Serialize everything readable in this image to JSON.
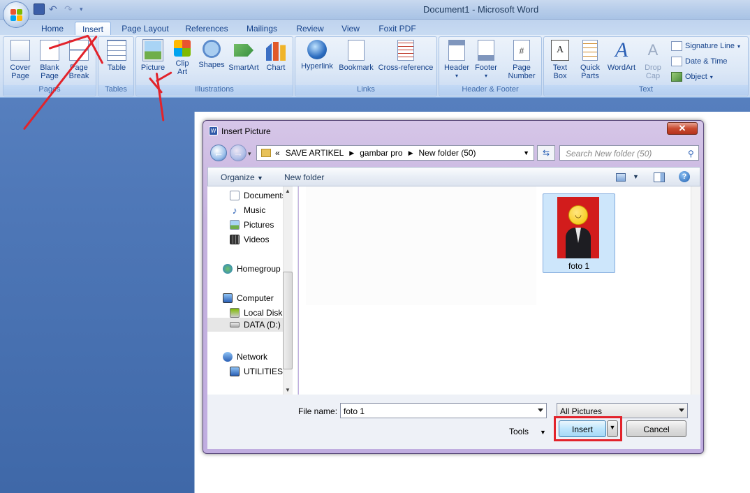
{
  "window": {
    "title": "Document1 - Microsoft Word"
  },
  "tabs": [
    "Home",
    "Insert",
    "Page Layout",
    "References",
    "Mailings",
    "Review",
    "View",
    "Foxit PDF"
  ],
  "active_tab": "Insert",
  "ribbon": {
    "pages": {
      "label": "Pages",
      "cover": "Cover\nPage",
      "blank": "Blank\nPage",
      "break": "Page\nBreak"
    },
    "tables": {
      "label": "Tables",
      "table": "Table"
    },
    "illustrations": {
      "label": "Illustrations",
      "picture": "Picture",
      "clipart": "Clip\nArt",
      "shapes": "Shapes",
      "smartart": "SmartArt",
      "chart": "Chart"
    },
    "links": {
      "label": "Links",
      "hyperlink": "Hyperlink",
      "bookmark": "Bookmark",
      "crossref": "Cross-reference"
    },
    "header_footer": {
      "label": "Header & Footer",
      "header": "Header",
      "footer": "Footer",
      "page_number": "Page\nNumber"
    },
    "text": {
      "label": "Text",
      "textbox": "Text\nBox",
      "quickparts": "Quick\nParts",
      "wordart": "WordArt",
      "dropcap": "Drop\nCap",
      "signature": "Signature Line",
      "datetime": "Date & Time",
      "object": "Object"
    }
  },
  "dialog": {
    "title": "Insert Picture",
    "breadcrumb": [
      "SAVE ARTIKEL",
      "gambar pro",
      "New folder (50)"
    ],
    "breadcrumb_prefix": "«",
    "search_placeholder": "Search New folder (50)",
    "toolbar": {
      "organize": "Organize",
      "new_folder": "New folder"
    },
    "nav": [
      "Documents",
      "Music",
      "Pictures",
      "Videos",
      "Homegroup",
      "Computer",
      "Local Disk (",
      "DATA (D:)",
      "Network",
      "UTILITIES-D"
    ],
    "file": {
      "name": "foto 1"
    },
    "filename_label": "File name:",
    "filename_value": "foto 1",
    "filter": "All Pictures",
    "tools": "Tools",
    "insert": "Insert",
    "cancel": "Cancel"
  },
  "colors": {
    "annotation": "#e2232b",
    "ribbon": "#dfe9f7"
  }
}
